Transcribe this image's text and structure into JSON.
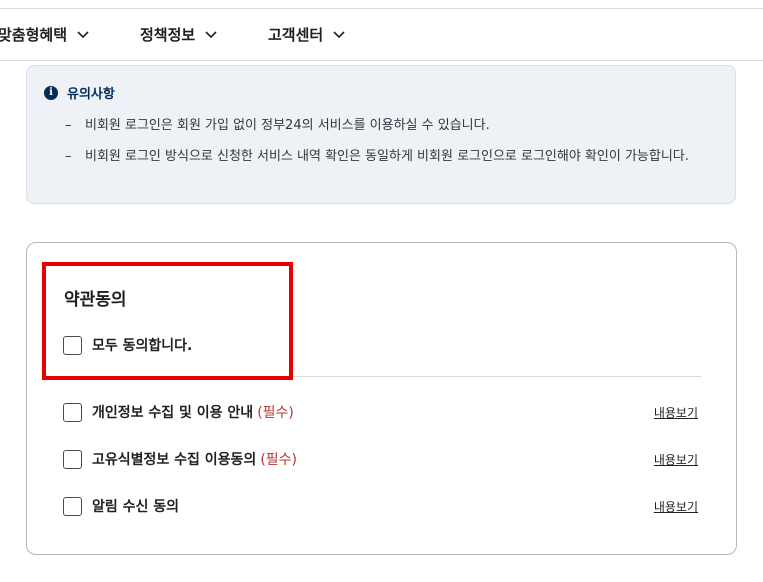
{
  "nav": {
    "items": [
      {
        "label": "맞춤형혜택"
      },
      {
        "label": "정책정보"
      },
      {
        "label": "고객센터"
      }
    ]
  },
  "notice": {
    "title": "유의사항",
    "icon": "info-icon",
    "items": [
      "비회원 로그인은 회원 가입 없이 정부24의 서비스를 이용하실 수 있습니다.",
      "비회원 로그인 방식으로 신청한 서비스 내역 확인은 동일하게 비회원 로그인으로 로그인해야 확인이 가능합니다."
    ]
  },
  "terms": {
    "title": "약관동의",
    "agree_all": "모두 동의합니다.",
    "items": [
      {
        "label": "개인정보 수집 및 이용 안내",
        "required": "(필수)",
        "link": "내용보기"
      },
      {
        "label": "고유식별정보 수집 이용동의",
        "required": "(필수)",
        "link": "내용보기"
      },
      {
        "label": "알림 수신 동의",
        "required": "",
        "link": "내용보기"
      }
    ]
  },
  "colors": {
    "highlight": "#e60000",
    "required": "#b3372c",
    "notice_bg": "#eef2f7",
    "notice_title": "#052b57"
  }
}
